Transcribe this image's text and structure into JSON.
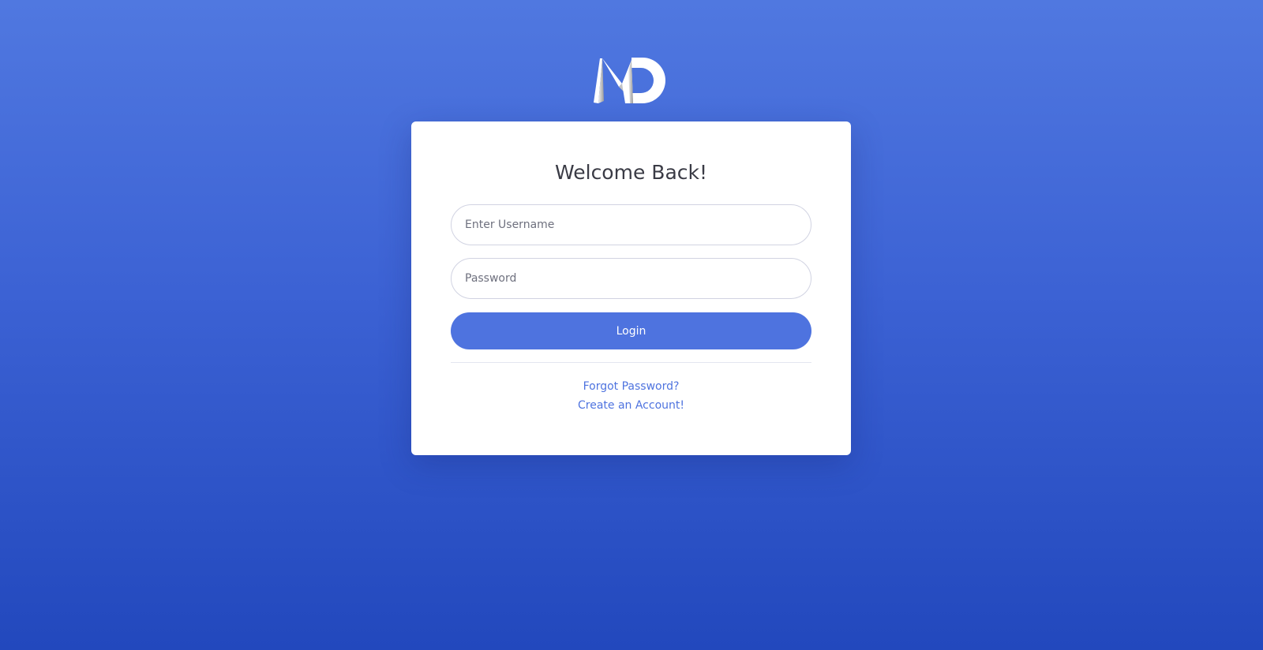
{
  "brand": {
    "logo_icon": "md-logo-icon",
    "logo_letters": "MD"
  },
  "login_card": {
    "title": "Welcome Back!",
    "username_placeholder": "Enter Username",
    "password_placeholder": "Password",
    "login_label": "Login",
    "forgot_password_label": "Forgot Password?",
    "create_account_label": "Create an Account!"
  },
  "colors": {
    "background_top": "#5078e0",
    "background_bottom": "#2248bd",
    "primary": "#4e73df",
    "card": "#ffffff",
    "title_text": "#3a3b45"
  }
}
